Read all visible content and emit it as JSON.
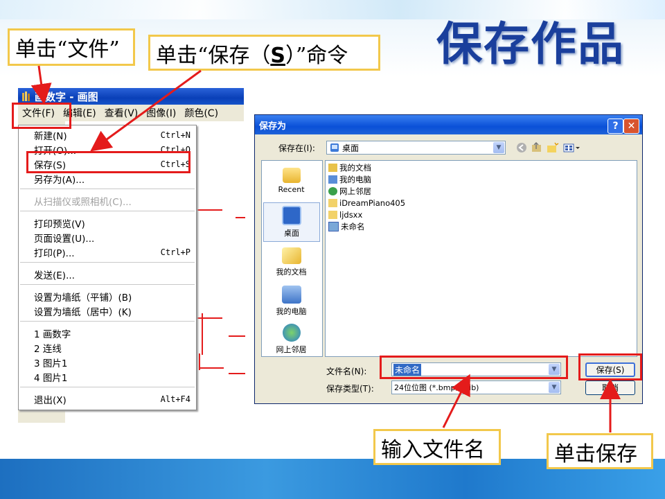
{
  "slide": {
    "title": "保存作品",
    "callout_file": "单击“文件”",
    "callout_save_pre": "单击“保存（",
    "callout_save_key": "S",
    "callout_save_post": "）”命令",
    "callout_filename": "输入文件名",
    "callout_click_save": "单击保存"
  },
  "paint": {
    "window_title": "画数字 - 画图",
    "menus": [
      "文件(F)",
      "编辑(E)",
      "查看(V)",
      "图像(I)",
      "颜色(C)"
    ],
    "file_menu": [
      {
        "label": "新建(N)",
        "shortcut": "Ctrl+N"
      },
      {
        "label": "打开(O)...",
        "shortcut": "Ctrl+O"
      },
      {
        "label": "保存(S)",
        "shortcut": "Ctrl+S"
      },
      {
        "label": "另存为(A)...",
        "shortcut": ""
      },
      {
        "label": "从扫描仪或照相机(C)...",
        "shortcut": ""
      },
      {
        "label": "打印预览(V)",
        "shortcut": ""
      },
      {
        "label": "页面设置(U)...",
        "shortcut": ""
      },
      {
        "label": "打印(P)...",
        "shortcut": "Ctrl+P"
      },
      {
        "label": "发送(E)...",
        "shortcut": ""
      },
      {
        "label": "设置为墙纸（平铺）(B)",
        "shortcut": ""
      },
      {
        "label": "设置为墙纸（居中）(K)",
        "shortcut": ""
      },
      {
        "label": "1 画数字",
        "shortcut": ""
      },
      {
        "label": "2 连线",
        "shortcut": ""
      },
      {
        "label": "3 图片1",
        "shortcut": ""
      },
      {
        "label": "4 图片1",
        "shortcut": ""
      },
      {
        "label": "退出(X)",
        "shortcut": "Alt+F4"
      }
    ]
  },
  "dialog": {
    "title": "保存为",
    "help_btn": "?",
    "close_btn": "✕",
    "save_in_label": "保存在(I):",
    "save_in_value": "桌面",
    "places": [
      "Recent",
      "桌面",
      "我的文档",
      "我的电脑",
      "网上邻居"
    ],
    "files": [
      "我的文档",
      "我的电脑",
      "网上邻居",
      "iDreamPiano405",
      "ljdsxx",
      "未命名"
    ],
    "filename_label": "文件名(N):",
    "filename_value": "未命名",
    "filetype_label": "保存类型(T):",
    "filetype_value": "24位位图 (*.bmp;*.dib)",
    "save_button": "保存(S)",
    "cancel_button": "取消"
  },
  "colors": {
    "accent_red": "#e41b1b",
    "callout_border": "#f2c84b",
    "title_blue": "#1a3f9c"
  }
}
